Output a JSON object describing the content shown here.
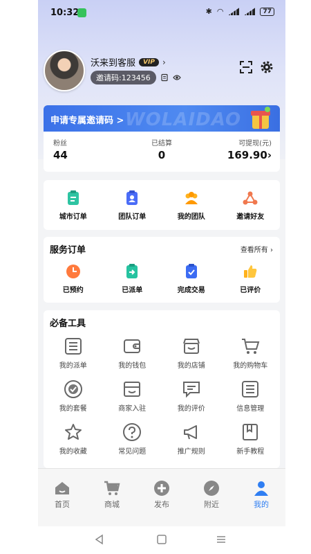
{
  "status": {
    "time": "10:32",
    "battery": "77"
  },
  "profile": {
    "name": "沃来到客服",
    "vip": "VIP",
    "invite_code": "邀请码:123456"
  },
  "banner": {
    "title": "申请专属邀请码 >",
    "watermark": "WOLAIDAO"
  },
  "stats": [
    {
      "label": "粉丝",
      "value": "44"
    },
    {
      "label": "已结算",
      "value": "0"
    },
    {
      "label": "可提现(元)",
      "value": "169.90"
    }
  ],
  "quick": [
    {
      "label": "城市订单",
      "icon": "city-order-icon"
    },
    {
      "label": "团队订单",
      "icon": "team-order-icon"
    },
    {
      "label": "我的团队",
      "icon": "my-team-icon"
    },
    {
      "label": "邀请好友",
      "icon": "invite-friend-icon"
    }
  ],
  "service": {
    "title": "服务订单",
    "see_all": "查看所有",
    "items": [
      {
        "label": "已预约",
        "icon": "clock-icon"
      },
      {
        "label": "已派单",
        "icon": "dispatch-icon"
      },
      {
        "label": "完成交易",
        "icon": "check-icon"
      },
      {
        "label": "已评价",
        "icon": "thumb-up-icon"
      }
    ]
  },
  "tools": {
    "title": "必备工具",
    "items": [
      {
        "label": "我的派单"
      },
      {
        "label": "我的钱包"
      },
      {
        "label": "我的店铺"
      },
      {
        "label": "我的购物车"
      },
      {
        "label": "我的套餐"
      },
      {
        "label": "商家入驻"
      },
      {
        "label": "我的评价"
      },
      {
        "label": "信息管理"
      },
      {
        "label": "我的收藏"
      },
      {
        "label": "常见问题"
      },
      {
        "label": "推广规则"
      },
      {
        "label": "新手教程"
      }
    ]
  },
  "tabs": [
    {
      "label": "首页"
    },
    {
      "label": "商城"
    },
    {
      "label": "发布"
    },
    {
      "label": "附近"
    },
    {
      "label": "我的"
    }
  ],
  "colors": {
    "accent": "#2f7ef2",
    "banner": "#3b71e8"
  }
}
